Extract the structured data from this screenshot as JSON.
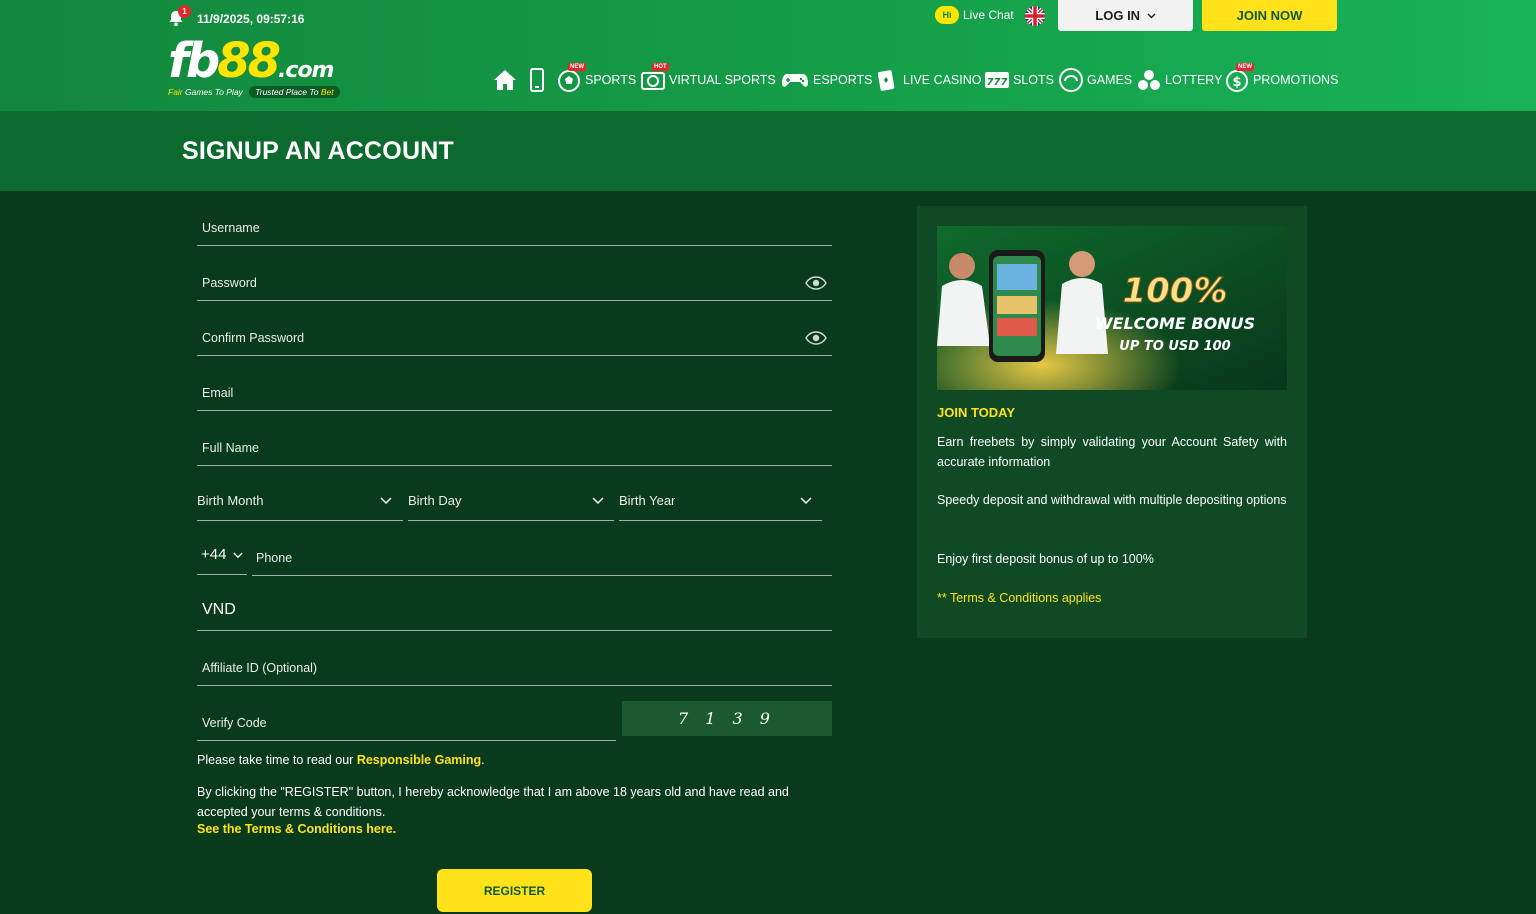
{
  "header": {
    "notification_count": "1",
    "datetime": "11/9/2025, 09:57:16",
    "logo": {
      "fb": "fb",
      "num": "88",
      "com": ".com",
      "tagline_1_pre": "Fair",
      "tagline_1_post": " Games To Play",
      "tagline_2_pre": "Trusted Place To ",
      "tagline_2_post": "Bet"
    },
    "live_chat_badge": "Hi",
    "live_chat_label": "Live Chat",
    "login_label": "LOG IN",
    "join_label": "JOIN NOW"
  },
  "nav": {
    "items": [
      {
        "label": "SPORTS",
        "badge": "NEW",
        "icon": "soccer-ball-icon"
      },
      {
        "label": "VIRTUAL SPORTS",
        "badge": "HOT",
        "icon": "virtual-sports-icon"
      },
      {
        "label": "ESPORTS",
        "icon": "gamepad-icon"
      },
      {
        "label": "LIVE CASINO",
        "icon": "cards-icon"
      },
      {
        "label": "SLOTS",
        "icon": "slots-777-icon"
      },
      {
        "label": "GAMES",
        "icon": "games-icon"
      },
      {
        "label": "LOTTERY",
        "icon": "lottery-balls-icon"
      },
      {
        "label": "PROMOTIONS",
        "badge": "NEW",
        "icon": "dollar-coin-icon"
      }
    ]
  },
  "page": {
    "title": "SIGNUP AN ACCOUNT"
  },
  "form": {
    "username_placeholder": "Username",
    "password_placeholder": "Password",
    "confirm_password_placeholder": "Confirm Password",
    "email_placeholder": "Email",
    "full_name_placeholder": "Full Name",
    "birth_month": "Birth Month",
    "birth_day": "Birth Day",
    "birth_year": "Birth Year",
    "phone_prefix": "+44",
    "phone_placeholder": "Phone",
    "currency": "VND",
    "affiliate_placeholder": "Affiliate ID (Optional)",
    "verify_placeholder": "Verify Code",
    "captcha": "7139",
    "responsible_pre": "Please take time to read our ",
    "responsible_link": "Responsible Gaming",
    "responsible_post": ".",
    "acknowledge": "By clicking the \"REGISTER\" button, I hereby acknowledge that I am above 18 years old and have read and accepted your terms & conditions.",
    "terms_link": "See the Terms & Conditions here.",
    "register_label": "REGISTER"
  },
  "promo": {
    "banner": {
      "headline": "100%",
      "line2": "WELCOME BONUS",
      "line3": "UP TO USD 100"
    },
    "heading": "JOIN TODAY",
    "p1": "Earn freebets by simply validating your Account Safety with accurate information",
    "p2": "Speedy deposit and withdrawal with multiple depositing options",
    "p3": "Enjoy first deposit bonus of up to 100%",
    "terms": "** Terms & Conditions applies"
  },
  "colors": {
    "header_green": "#13873c",
    "title_band": "#0d6a2e",
    "body_bg": "#0a3a1c",
    "panel_bg": "#0f4a24",
    "accent_yellow": "#ffe21a"
  }
}
